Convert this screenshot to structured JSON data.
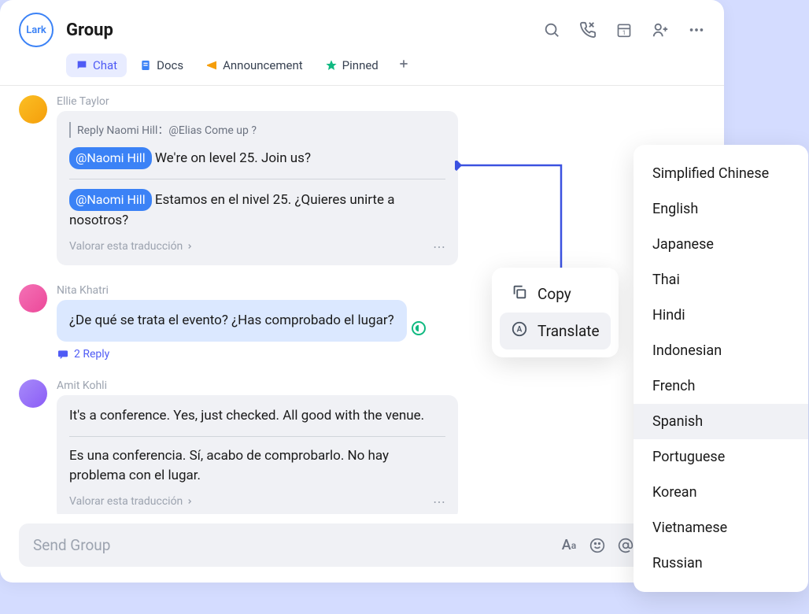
{
  "header": {
    "logo_text": "Lark",
    "title": "Group",
    "tabs": [
      {
        "label": "Chat",
        "active": true,
        "icon": "chat-icon"
      },
      {
        "label": "Docs",
        "active": false,
        "icon": "docs-icon"
      },
      {
        "label": "Announcement",
        "active": false,
        "icon": "announcement-icon"
      },
      {
        "label": "Pinned",
        "active": false,
        "icon": "pin-icon"
      }
    ]
  },
  "messages": [
    {
      "sender": "Ellie Taylor",
      "avatar_class": "ellie",
      "reply_quote": "Reply Naomi Hill：@Elias Come up ?",
      "mention": "@Naomi Hill",
      "text_original": "We're on level 25. Join us?",
      "text_translated": "Estamos en el nivel 25. ¿Quieres unirte a nosotros?",
      "rate_label": "Valorar esta traducción"
    },
    {
      "sender": "Nita Khatri",
      "avatar_class": "nita",
      "text": "¿De qué se trata el evento? ¿Has comprobado el lugar?",
      "reply_count": "2 Reply"
    },
    {
      "sender": "Amit Kohli",
      "avatar_class": "amit",
      "text_original": "It's a conference. Yes, just checked. All good with the venue.",
      "text_translated": "Es una conferencia. Sí, acabo de comprobarlo. No hay problema con el lugar.",
      "rate_label": "Valorar esta traducción"
    }
  ],
  "composer": {
    "placeholder": "Send Group"
  },
  "context_menu": {
    "items": [
      {
        "label": "Copy",
        "icon": "copy-icon",
        "active": false
      },
      {
        "label": "Translate",
        "icon": "translate-icon",
        "active": true
      }
    ]
  },
  "lang_menu": {
    "items": [
      "Simplified Chinese",
      "English",
      "Japanese",
      "Thai",
      "Hindi",
      "Indonesian",
      "French",
      "Spanish",
      "Portuguese",
      "Korean",
      "Vietnamese",
      "Russian"
    ],
    "active_index": 7
  }
}
